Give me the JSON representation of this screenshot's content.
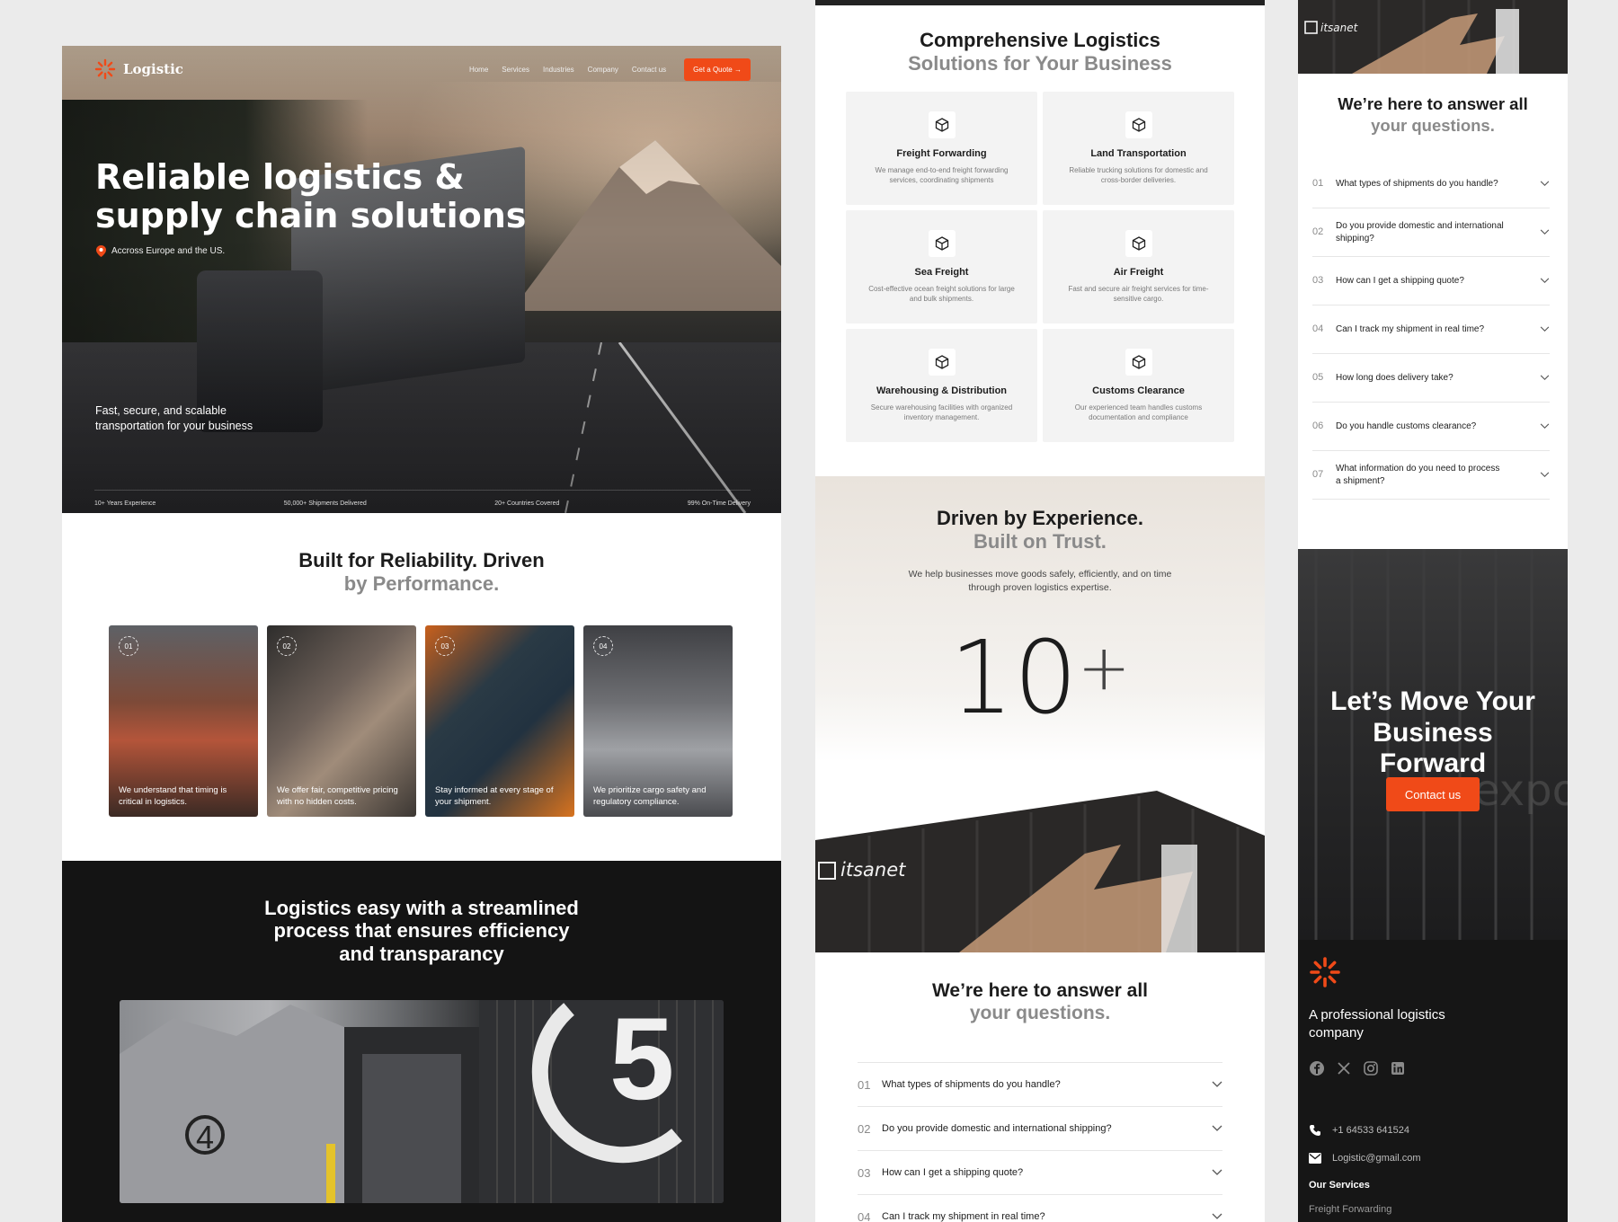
{
  "colors": {
    "accent": "#f04a18",
    "dark": "#141414",
    "muted": "#8a8a8a"
  },
  "nav": {
    "brand": "Logistic",
    "links": [
      "Home",
      "Services",
      "Industries",
      "Company",
      "Contact us"
    ],
    "cta": "Get a Quote"
  },
  "hero": {
    "title": "Reliable logistics & supply chain solutions",
    "location": "Accross Europe and the US.",
    "subtitle": "Fast, secure, and scalable transportation for your business",
    "stats": [
      "10+ Years Experience",
      "50,000+ Shipments Delivered",
      "20+ Countries Covered",
      "99% On-Time Delivery"
    ]
  },
  "reliability": {
    "title_line1": "Built for Reliability. Driven",
    "title_line2": "by Performance.",
    "cards": [
      {
        "num": "01",
        "text": "We understand that timing is critical in logistics."
      },
      {
        "num": "02",
        "text": "We offer fair, competitive pricing with no hidden costs."
      },
      {
        "num": "03",
        "text": "Stay informed at every stage of your shipment."
      },
      {
        "num": "04",
        "text": "We prioritize cargo safety and regulatory compliance."
      }
    ]
  },
  "process": {
    "title": "Logistics easy with a streamlined process that ensures efficiency and transparancy"
  },
  "services": {
    "title_line1": "Comprehensive Logistics",
    "title_line2": "Solutions for Your Business",
    "items": [
      {
        "name": "Freight Forwarding",
        "desc": "We manage end-to-end freight forwarding services, coordinating shipments"
      },
      {
        "name": "Land Transportation",
        "desc": "Reliable trucking solutions for domestic and cross-border deliveries."
      },
      {
        "name": "Sea Freight",
        "desc": "Cost-effective ocean freight solutions for large and bulk shipments."
      },
      {
        "name": "Air Freight",
        "desc": "Fast and secure air freight services for time-sensitive cargo."
      },
      {
        "name": "Warehousing & Distribution",
        "desc": "Secure warehousing facilities with organized inventory management."
      },
      {
        "name": "Customs Clearance",
        "desc": "Our experienced team handles customs documentation and compliance"
      }
    ]
  },
  "experience": {
    "title_line1": "Driven by Experience.",
    "title_line2": "Built on Trust.",
    "desc": "We help businesses move goods safely, efficiently, and on time through proven logistics expertise.",
    "number": "10",
    "suffix": "+",
    "container_brand": "itsanet"
  },
  "faq": {
    "title_line1": "We’re here to answer all",
    "title_line2": "your questions.",
    "items": [
      {
        "num": "01",
        "q": "What types of shipments do you handle?"
      },
      {
        "num": "02",
        "q": "Do you provide domestic and international shipping?"
      },
      {
        "num": "03",
        "q": "How can I get a shipping quote?"
      },
      {
        "num": "04",
        "q": "Can I track my shipment in real time?"
      },
      {
        "num": "05",
        "q": "How long does delivery take?"
      },
      {
        "num": "06",
        "q": "Do you handle customs clearance?"
      },
      {
        "num": "07",
        "q": "What information do you need to process a shipment?"
      }
    ]
  },
  "cta": {
    "title": "Let’s Move Your Business Forward",
    "button": "Contact us",
    "bg_text": "expo"
  },
  "footer": {
    "tagline": "A professional logistics company",
    "social_icons": [
      "facebook-icon",
      "x-icon",
      "instagram-icon",
      "linkedin-icon"
    ],
    "phone": "+1 64533 641524",
    "email": "Logistic@gmail.com",
    "services_heading": "Our Services",
    "services_first": "Freight Forwarding"
  }
}
